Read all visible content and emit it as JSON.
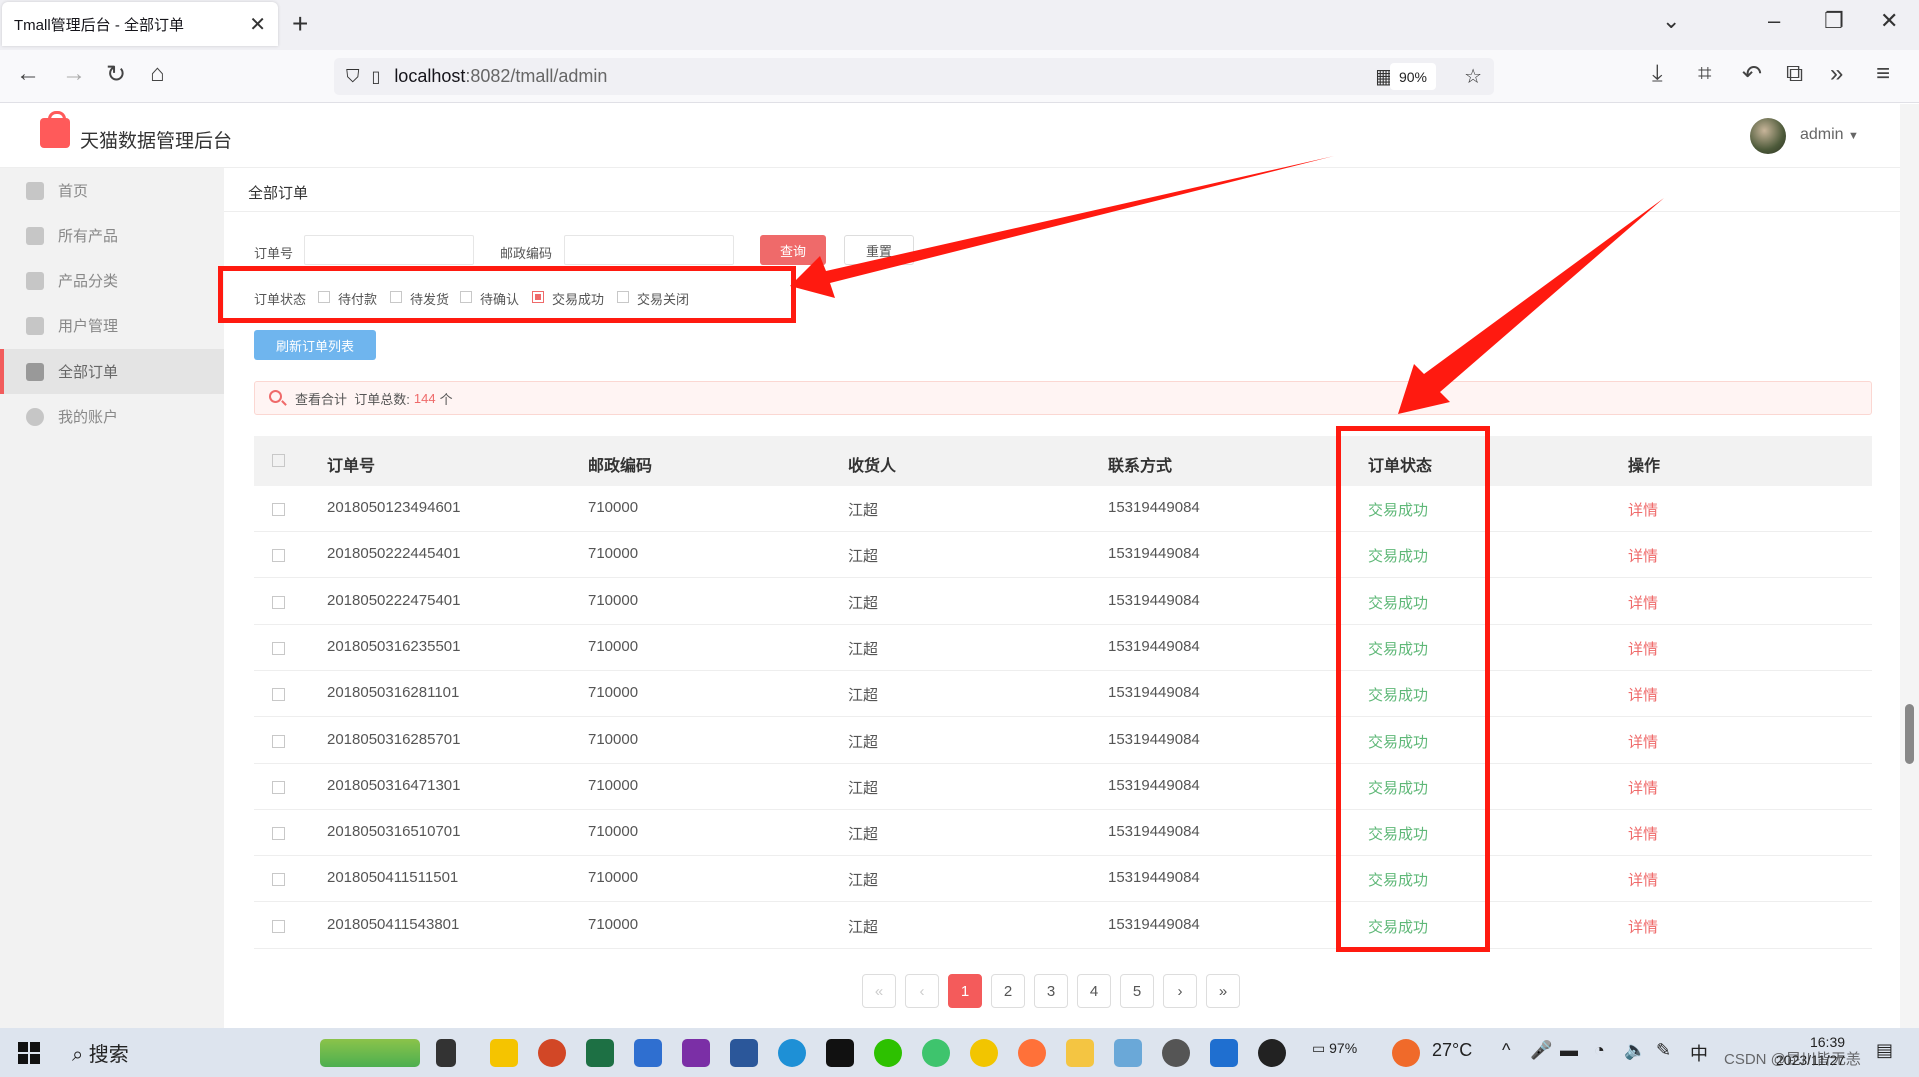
{
  "browser": {
    "tab_title": "Tmall管理后台 - 全部订单",
    "url_host": "localhost",
    "url_path": ":8082/tmall/admin",
    "zoom": "90%"
  },
  "app": {
    "title": "天猫数据管理后台",
    "user": "admin"
  },
  "sidebar": {
    "items": [
      {
        "label": "首页"
      },
      {
        "label": "所有产品"
      },
      {
        "label": "产品分类"
      },
      {
        "label": "用户管理"
      },
      {
        "label": "全部订单"
      },
      {
        "label": "我的账户"
      }
    ],
    "active_index": 4
  },
  "breadcrumb": "全部订单",
  "filters": {
    "order_no_label": "订单号",
    "order_no_value": "",
    "zip_label": "邮政编码",
    "zip_value": "",
    "query_btn": "查询",
    "reset_btn": "重置",
    "status_label": "订单状态",
    "statuses": [
      {
        "label": "待付款",
        "checked": false
      },
      {
        "label": "待发货",
        "checked": false
      },
      {
        "label": "待确认",
        "checked": false
      },
      {
        "label": "交易成功",
        "checked": true
      },
      {
        "label": "交易关闭",
        "checked": false
      }
    ],
    "refresh_btn": "刷新订单列表"
  },
  "summary": {
    "prefix": "查看合计",
    "count_label": "订单总数:",
    "count": "144",
    "unit": "个"
  },
  "table": {
    "columns": [
      "订单号",
      "邮政编码",
      "收货人",
      "联系方式",
      "订单状态",
      "操作"
    ],
    "rows": [
      [
        "2018050123494601",
        "710000",
        "江超",
        "15319449084",
        "交易成功",
        "详情"
      ],
      [
        "2018050222445401",
        "710000",
        "江超",
        "15319449084",
        "交易成功",
        "详情"
      ],
      [
        "2018050222475401",
        "710000",
        "江超",
        "15319449084",
        "交易成功",
        "详情"
      ],
      [
        "2018050316235501",
        "710000",
        "江超",
        "15319449084",
        "交易成功",
        "详情"
      ],
      [
        "2018050316281101",
        "710000",
        "江超",
        "15319449084",
        "交易成功",
        "详情"
      ],
      [
        "2018050316285701",
        "710000",
        "江超",
        "15319449084",
        "交易成功",
        "详情"
      ],
      [
        "2018050316471301",
        "710000",
        "江超",
        "15319449084",
        "交易成功",
        "详情"
      ],
      [
        "2018050316510701",
        "710000",
        "江超",
        "15319449084",
        "交易成功",
        "详情"
      ],
      [
        "2018050411511501",
        "710000",
        "江超",
        "15319449084",
        "交易成功",
        "详情"
      ],
      [
        "2018050411543801",
        "710000",
        "江超",
        "15319449084",
        "交易成功",
        "详情"
      ]
    ]
  },
  "pagination": {
    "first": "«",
    "prev": "‹",
    "pages": [
      "1",
      "2",
      "3",
      "4",
      "5"
    ],
    "current": "1",
    "next": "›",
    "last": "»"
  },
  "taskbar": {
    "search": "搜索",
    "battery": "97%",
    "weather": "27°C",
    "ime": "中",
    "time": "16:39",
    "date": "2023/11/27",
    "watermark": "CSDN @昆川皆无恙"
  },
  "colors": {
    "accent": "#ef6a6a",
    "success": "#5fb878",
    "annotation": "#ff1a10"
  }
}
